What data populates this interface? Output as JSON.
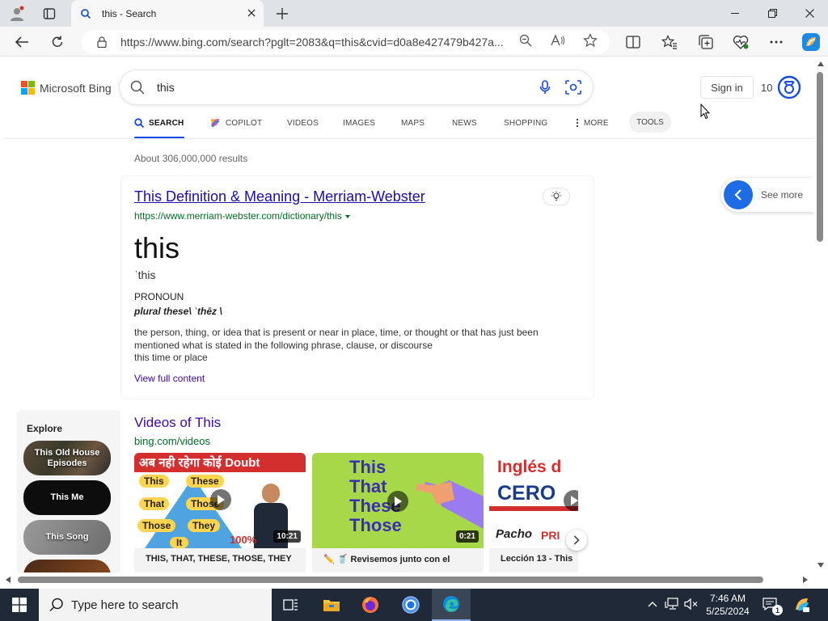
{
  "browser": {
    "tab_title": "this - Search",
    "url": "https://www.bing.com/search?pglt=2083&q=this&cvid=d0a8e427479b427a..."
  },
  "bing": {
    "logo_text": "Microsoft Bing",
    "query": "this",
    "signin_label": "Sign in",
    "rewards_count": "10",
    "scopes": {
      "search": "SEARCH",
      "copilot": "COPILOT",
      "videos": "VIDEOS",
      "images": "IMAGES",
      "maps": "MAPS",
      "news": "NEWS",
      "shopping": "SHOPPING",
      "more": "MORE",
      "tools": "TOOLS"
    },
    "result_count": "About 306,000,000 results",
    "see_more": "See more"
  },
  "result": {
    "title": "This Definition & Meaning - Merriam-Webster",
    "url": "https://www.merriam-webster.com/dictionary/this",
    "word": "this",
    "pronunciation": "ˈthis",
    "part_of_speech": "PRONOUN",
    "plural": "plural these\\ ˈthēz \\",
    "definition_1": "the person, thing, or idea that is present or near in place, time, or thought or that has just been mentioned what is stated in the following phrase, clause, or discourse",
    "definition_2": "this time or place",
    "view_full": "View full content"
  },
  "explore": {
    "title": "Explore",
    "items": [
      "This Old House Episodes",
      "This Me",
      "This Song"
    ]
  },
  "videos": {
    "title": "Videos of This",
    "source": "bing.com/videos",
    "items": [
      {
        "caption": "THIS, THAT, THESE, THOSE, THEY",
        "duration": "10:21",
        "thumb_banner": "अब नही रहेगा कोई Doubt",
        "thumb_words": [
          "This",
          "These",
          "That",
          "Those",
          "Those",
          "They",
          "It"
        ],
        "thumb_percent": "100%"
      },
      {
        "caption": "✏️ 🥤 Revisemos junto con el",
        "duration": "0:21",
        "thumb_words": [
          "This",
          "That",
          "These",
          "Those"
        ]
      },
      {
        "caption": "Lección 13 - This",
        "thumb_words": [
          "Inglés d",
          "CERO",
          "Pacho",
          "PRI"
        ]
      }
    ]
  },
  "taskbar": {
    "search_placeholder": "Type here to search",
    "time": "7:46 AM",
    "date": "5/25/2024",
    "notification_count": "1"
  },
  "colors": {
    "link": "#1a0dab",
    "visited": "#4007a2",
    "url_green": "#006d21",
    "accent_blue": "#174ae4"
  }
}
